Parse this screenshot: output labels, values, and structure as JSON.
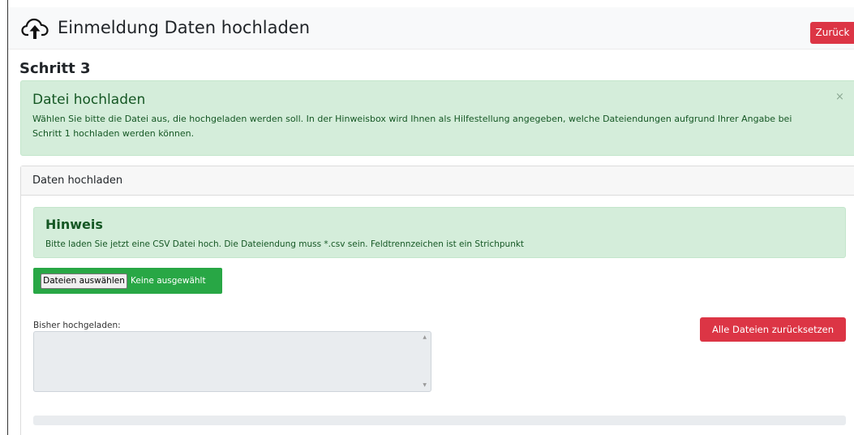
{
  "header": {
    "title": "Einmeldung Daten hochladen",
    "back_label": "Zurück",
    "logo_icon": "cloud-upload-icon"
  },
  "step": {
    "title": "Schritt 3"
  },
  "alert": {
    "heading": "Datei hochladen",
    "text": "Wählen Sie bitte die Datei aus, die hochgeladen werden soll. In der Hinweisbox wird Ihnen als Hilfestellung angegeben, welche Dateiendungen aufgrund Ihrer Angabe bei Schritt 1 hochladen werden können.",
    "close_label": "×"
  },
  "card": {
    "header": "Daten hochladen",
    "hint": {
      "heading": "Hinweis",
      "text": "Bitte laden Sie jetzt eine CSV Datei hoch. Die Dateiendung muss *.csv sein. Feldtrennzeichen ist ein Strichpunkt"
    },
    "file_input": {
      "button_label": "Dateien auswählen",
      "status": "Keine ausgewählt"
    },
    "uploaded": {
      "label": "Bisher hochgeladen:",
      "value": ""
    },
    "reset_label": "Alle Dateien zurücksetzen"
  },
  "colors": {
    "danger": "#dc3545",
    "success": "#28a745",
    "alert_bg": "#d4edda",
    "alert_text": "#155724"
  }
}
